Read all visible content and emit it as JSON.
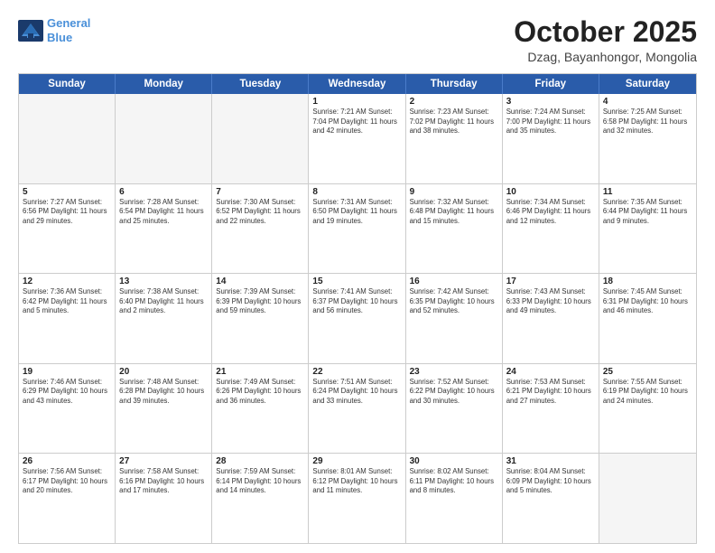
{
  "header": {
    "logo_line1": "General",
    "logo_line2": "Blue",
    "title": "October 2025",
    "subtitle": "Dzag, Bayanhongor, Mongolia"
  },
  "day_headers": [
    "Sunday",
    "Monday",
    "Tuesday",
    "Wednesday",
    "Thursday",
    "Friday",
    "Saturday"
  ],
  "weeks": [
    [
      {
        "day": "",
        "info": ""
      },
      {
        "day": "",
        "info": ""
      },
      {
        "day": "",
        "info": ""
      },
      {
        "day": "1",
        "info": "Sunrise: 7:21 AM\nSunset: 7:04 PM\nDaylight: 11 hours\nand 42 minutes."
      },
      {
        "day": "2",
        "info": "Sunrise: 7:23 AM\nSunset: 7:02 PM\nDaylight: 11 hours\nand 38 minutes."
      },
      {
        "day": "3",
        "info": "Sunrise: 7:24 AM\nSunset: 7:00 PM\nDaylight: 11 hours\nand 35 minutes."
      },
      {
        "day": "4",
        "info": "Sunrise: 7:25 AM\nSunset: 6:58 PM\nDaylight: 11 hours\nand 32 minutes."
      }
    ],
    [
      {
        "day": "5",
        "info": "Sunrise: 7:27 AM\nSunset: 6:56 PM\nDaylight: 11 hours\nand 29 minutes."
      },
      {
        "day": "6",
        "info": "Sunrise: 7:28 AM\nSunset: 6:54 PM\nDaylight: 11 hours\nand 25 minutes."
      },
      {
        "day": "7",
        "info": "Sunrise: 7:30 AM\nSunset: 6:52 PM\nDaylight: 11 hours\nand 22 minutes."
      },
      {
        "day": "8",
        "info": "Sunrise: 7:31 AM\nSunset: 6:50 PM\nDaylight: 11 hours\nand 19 minutes."
      },
      {
        "day": "9",
        "info": "Sunrise: 7:32 AM\nSunset: 6:48 PM\nDaylight: 11 hours\nand 15 minutes."
      },
      {
        "day": "10",
        "info": "Sunrise: 7:34 AM\nSunset: 6:46 PM\nDaylight: 11 hours\nand 12 minutes."
      },
      {
        "day": "11",
        "info": "Sunrise: 7:35 AM\nSunset: 6:44 PM\nDaylight: 11 hours\nand 9 minutes."
      }
    ],
    [
      {
        "day": "12",
        "info": "Sunrise: 7:36 AM\nSunset: 6:42 PM\nDaylight: 11 hours\nand 5 minutes."
      },
      {
        "day": "13",
        "info": "Sunrise: 7:38 AM\nSunset: 6:40 PM\nDaylight: 11 hours\nand 2 minutes."
      },
      {
        "day": "14",
        "info": "Sunrise: 7:39 AM\nSunset: 6:39 PM\nDaylight: 10 hours\nand 59 minutes."
      },
      {
        "day": "15",
        "info": "Sunrise: 7:41 AM\nSunset: 6:37 PM\nDaylight: 10 hours\nand 56 minutes."
      },
      {
        "day": "16",
        "info": "Sunrise: 7:42 AM\nSunset: 6:35 PM\nDaylight: 10 hours\nand 52 minutes."
      },
      {
        "day": "17",
        "info": "Sunrise: 7:43 AM\nSunset: 6:33 PM\nDaylight: 10 hours\nand 49 minutes."
      },
      {
        "day": "18",
        "info": "Sunrise: 7:45 AM\nSunset: 6:31 PM\nDaylight: 10 hours\nand 46 minutes."
      }
    ],
    [
      {
        "day": "19",
        "info": "Sunrise: 7:46 AM\nSunset: 6:29 PM\nDaylight: 10 hours\nand 43 minutes."
      },
      {
        "day": "20",
        "info": "Sunrise: 7:48 AM\nSunset: 6:28 PM\nDaylight: 10 hours\nand 39 minutes."
      },
      {
        "day": "21",
        "info": "Sunrise: 7:49 AM\nSunset: 6:26 PM\nDaylight: 10 hours\nand 36 minutes."
      },
      {
        "day": "22",
        "info": "Sunrise: 7:51 AM\nSunset: 6:24 PM\nDaylight: 10 hours\nand 33 minutes."
      },
      {
        "day": "23",
        "info": "Sunrise: 7:52 AM\nSunset: 6:22 PM\nDaylight: 10 hours\nand 30 minutes."
      },
      {
        "day": "24",
        "info": "Sunrise: 7:53 AM\nSunset: 6:21 PM\nDaylight: 10 hours\nand 27 minutes."
      },
      {
        "day": "25",
        "info": "Sunrise: 7:55 AM\nSunset: 6:19 PM\nDaylight: 10 hours\nand 24 minutes."
      }
    ],
    [
      {
        "day": "26",
        "info": "Sunrise: 7:56 AM\nSunset: 6:17 PM\nDaylight: 10 hours\nand 20 minutes."
      },
      {
        "day": "27",
        "info": "Sunrise: 7:58 AM\nSunset: 6:16 PM\nDaylight: 10 hours\nand 17 minutes."
      },
      {
        "day": "28",
        "info": "Sunrise: 7:59 AM\nSunset: 6:14 PM\nDaylight: 10 hours\nand 14 minutes."
      },
      {
        "day": "29",
        "info": "Sunrise: 8:01 AM\nSunset: 6:12 PM\nDaylight: 10 hours\nand 11 minutes."
      },
      {
        "day": "30",
        "info": "Sunrise: 8:02 AM\nSunset: 6:11 PM\nDaylight: 10 hours\nand 8 minutes."
      },
      {
        "day": "31",
        "info": "Sunrise: 8:04 AM\nSunset: 6:09 PM\nDaylight: 10 hours\nand 5 minutes."
      },
      {
        "day": "",
        "info": ""
      }
    ]
  ]
}
